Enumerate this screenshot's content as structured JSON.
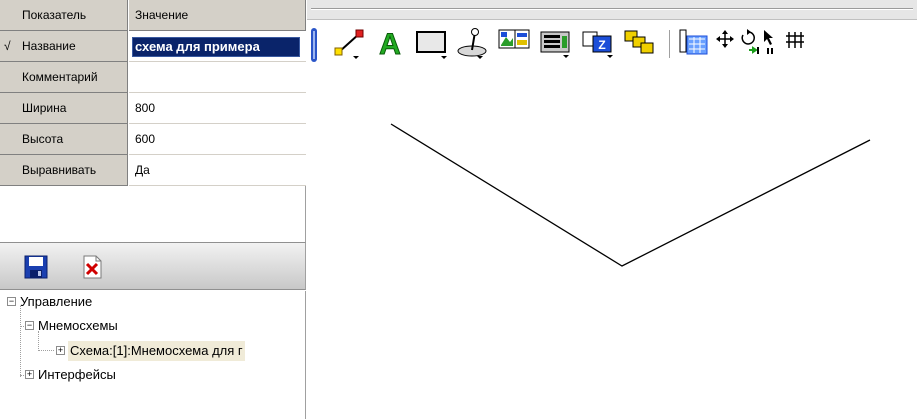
{
  "properties": {
    "header": {
      "name": "Показатель",
      "value": "Значение"
    },
    "rows": [
      {
        "name": "Название",
        "value": "схема для примера",
        "checked": true,
        "editing": true
      },
      {
        "name": "Комментарий",
        "value": ""
      },
      {
        "name": "Ширина",
        "value": "800"
      },
      {
        "name": "Высота",
        "value": "600"
      },
      {
        "name": "Выравнивать",
        "value": "Да"
      }
    ],
    "check_glyph": "√"
  },
  "tree_toolbar": {
    "buttons": [
      "save-icon",
      "delete-icon"
    ]
  },
  "tree": {
    "root": "Управление",
    "child1": "Мнемосхемы",
    "child1_item": "Схема:[1]:Мнемосхема для г",
    "child2": "Интерфейсы"
  },
  "toolbar": {
    "tools": [
      "line-tool-icon",
      "text-tool-icon",
      "rectangle-tool-icon",
      "joystick-tool-icon",
      "picture-tool-icon",
      "device-tool-icon",
      "zorder-tool-icon",
      "group-tool-icon",
      "properties-tool-icon",
      "move-icon",
      "rotate-icon",
      "pointer-icon",
      "grid-icon"
    ],
    "text_tool_glyph": "A"
  },
  "colors": {
    "selection": "#0a246a",
    "grid_header": "#d4d0c8",
    "accent_red": "#cc0000",
    "accent_green": "#1a9e1a"
  }
}
